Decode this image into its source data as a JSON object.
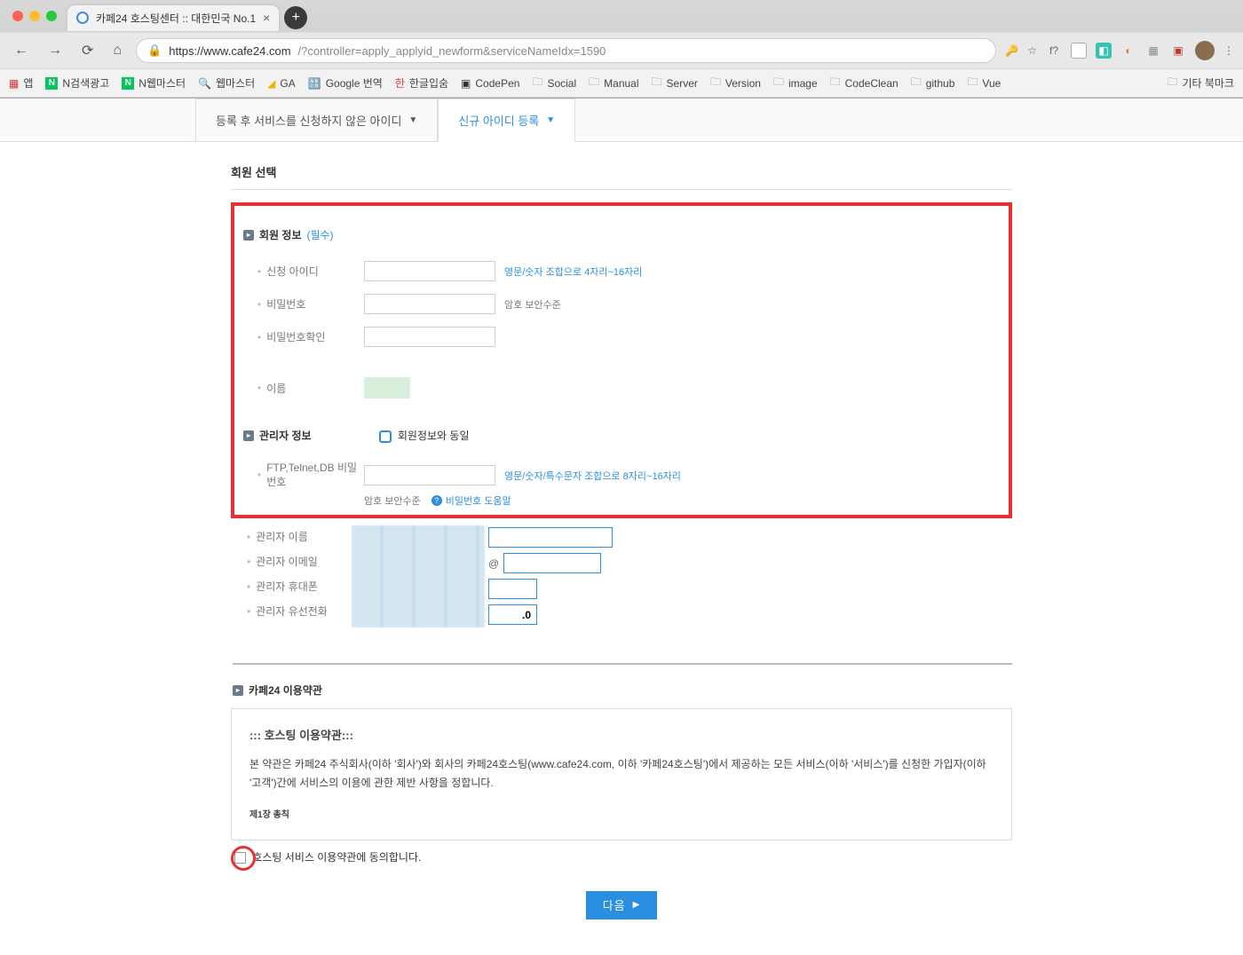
{
  "browser": {
    "tab_title": "카페24 호스팅센터 :: 대한민국 No.1",
    "url_origin": "https://www.cafe24.com",
    "url_path": "/?controller=apply_applyid_newform&serviceNameIdx=1590",
    "f_label": "f?"
  },
  "bookmarks": {
    "apps": "앱",
    "items": [
      "N검색광고",
      "N웹마스터",
      "웹마스터",
      "GA",
      "Google 번역",
      "한글입숨",
      "CodePen",
      "Social",
      "Manual",
      "Server",
      "Version",
      "image",
      "CodeClean",
      "github",
      "Vue"
    ],
    "other": "기타 북마크"
  },
  "page_tabs": {
    "left": "등록 후 서비스를 신청하지 않은 아이디",
    "right": "신규 아이디 등록"
  },
  "section": {
    "select_member": "회원 선택"
  },
  "member_info": {
    "heading": "회원 정보",
    "required": "(필수)",
    "id_label": "신청 아이디",
    "id_hint": "영문/숫자 조합으로 4자리~16자리",
    "pw_label": "비밀번호",
    "pw_strength": "암호 보안수준",
    "pw2_label": "비밀번호확인",
    "name_label": "이름"
  },
  "admin_info": {
    "heading": "관리자 정보",
    "same_as": "회원정보와 동일",
    "ftp_label": "FTP,Telnet,DB 비밀번호",
    "ftp_hint": "영문/숫자/특수문자 조합으로 8자리~16자리",
    "pw_strength": "암호 보안수준",
    "pw_help": "비밀번호 도움말",
    "name": "관리자 이름",
    "email": "관리자 이메일",
    "phone": "관리자 휴대폰",
    "tel": "관리자 유선전화",
    "tel_code": ".0"
  },
  "terms": {
    "heading": "카페24 이용약관",
    "title": "::: 호스팅 이용약관:::",
    "body": "본 약관은 카페24 주식회사(이하 '회사')와 회사의 카페24호스팅(www.cafe24.com, 이하 '카페24호스팅')에서 제공하는 모든 서비스(이하 '서비스')를 신청한 가입자(이하 '고객')간에 서비스의 이용에 관한 제반 사항을 정합니다.",
    "chapter": "제1장 총칙",
    "agree": "호스팅 서비스 이용약관에 동의합니다."
  },
  "next_button": "다음",
  "at_symbol": "@"
}
